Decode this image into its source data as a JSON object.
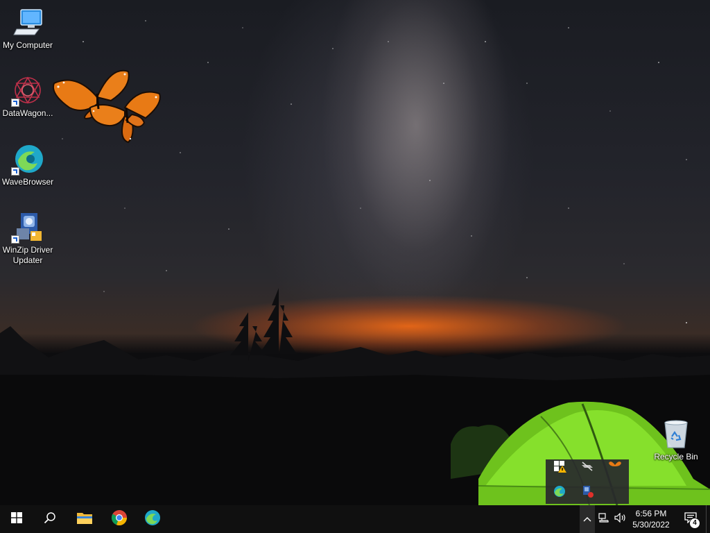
{
  "desktop": {
    "icons": [
      {
        "label": "My Computer",
        "icon": "computer-icon"
      },
      {
        "label": "DataWagon...",
        "icon": "datawagon-icon"
      },
      {
        "label": "WaveBrowser",
        "icon": "wavebrowser-icon"
      },
      {
        "label": "WinZip Driver Updater",
        "icon": "winzip-driver-updater-icon"
      },
      {
        "label": "Recycle Bin",
        "icon": "recycle-bin-icon"
      }
    ],
    "overlay": "butterfly-icon"
  },
  "tray_flyout": {
    "icons": [
      "security-warning-icon",
      "hidden-network-icon",
      "butterfly-icon",
      "wavebrowser-icon",
      "winzip-driver-icon"
    ]
  },
  "taskbar": {
    "pinned": [
      "start-icon",
      "search-icon",
      "file-explorer-icon",
      "chrome-icon",
      "wavebrowser-icon"
    ],
    "tray": [
      "chevron-up-icon",
      "network-icon",
      "volume-icon"
    ],
    "clock": {
      "time": "6:56 PM",
      "date": "5/30/2022"
    },
    "notifications": {
      "count": "4"
    }
  },
  "colors": {
    "taskbar": "#101010",
    "tent": "#7bd321"
  }
}
